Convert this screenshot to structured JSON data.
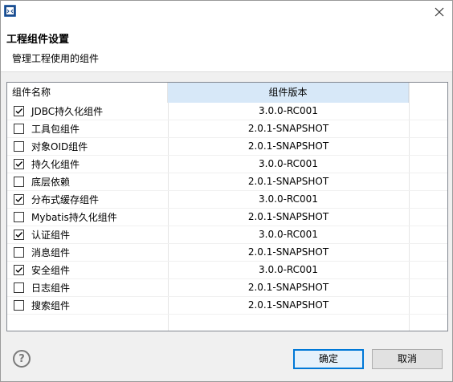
{
  "dialog": {
    "title": "工程组件设置",
    "subtitle": "管理工程使用的组件"
  },
  "table": {
    "headers": {
      "name": "组件名称",
      "version": "组件版本"
    },
    "rows": [
      {
        "name": "JDBC持久化组件",
        "version": "3.0.0-RC001",
        "checked": true
      },
      {
        "name": "工具包组件",
        "version": "2.0.1-SNAPSHOT",
        "checked": false
      },
      {
        "name": "对象OID组件",
        "version": "2.0.1-SNAPSHOT",
        "checked": false
      },
      {
        "name": "持久化组件",
        "version": "3.0.0-RC001",
        "checked": true
      },
      {
        "name": "底层依赖",
        "version": "2.0.1-SNAPSHOT",
        "checked": false
      },
      {
        "name": "分布式缓存组件",
        "version": "3.0.0-RC001",
        "checked": true
      },
      {
        "name": "Mybatis持久化组件",
        "version": "2.0.1-SNAPSHOT",
        "checked": false
      },
      {
        "name": "认证组件",
        "version": "3.0.0-RC001",
        "checked": true
      },
      {
        "name": "消息组件",
        "version": "2.0.1-SNAPSHOT",
        "checked": false
      },
      {
        "name": "安全组件",
        "version": "3.0.0-RC001",
        "checked": true
      },
      {
        "name": "日志组件",
        "version": "2.0.1-SNAPSHOT",
        "checked": false
      },
      {
        "name": "搜索组件",
        "version": "2.0.1-SNAPSHOT",
        "checked": false
      }
    ]
  },
  "buttons": {
    "ok": "确定",
    "cancel": "取消",
    "help": "?"
  },
  "icons": {
    "app": "app-icon",
    "close": "close-icon",
    "help": "help-icon",
    "check": "checkmark-icon"
  },
  "colors": {
    "header_highlight": "#d7e8f8",
    "primary_border": "#0078d7"
  }
}
